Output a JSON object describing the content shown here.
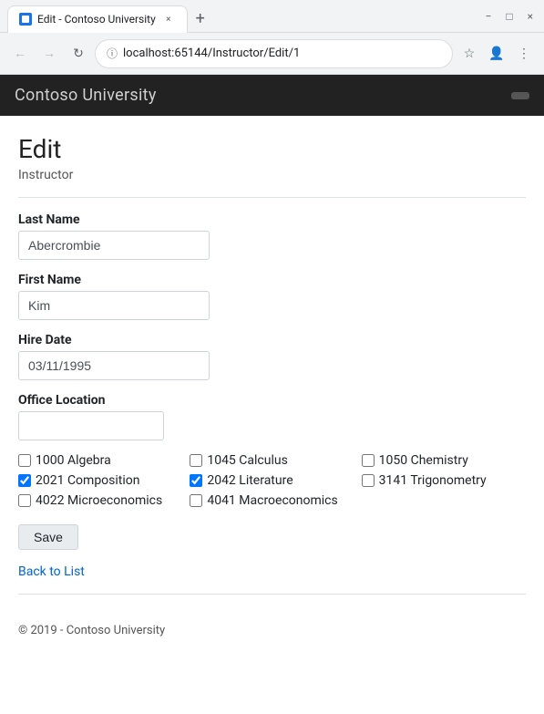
{
  "browser": {
    "tab_title": "Edit - Contoso University",
    "url": "localhost:65144/Instructor/Edit/1",
    "new_tab_symbol": "+",
    "close_symbol": "×",
    "back_symbol": "←",
    "forward_symbol": "→",
    "reload_symbol": "↻",
    "star_symbol": "☆",
    "account_symbol": "👤",
    "menu_symbol": "⋮",
    "lock_symbol": "🔒",
    "window_minimize": "−",
    "window_maximize": "□",
    "window_close": "×"
  },
  "navbar": {
    "brand": "Contoso University",
    "button_label": ""
  },
  "page": {
    "title": "Edit",
    "subtitle": "Instructor"
  },
  "form": {
    "last_name_label": "Last Name",
    "last_name_value": "Abercrombie",
    "first_name_label": "First Name",
    "first_name_value": "Kim",
    "hire_date_label": "Hire Date",
    "hire_date_value": "03/11/1995",
    "office_location_label": "Office Location",
    "office_location_value": "",
    "save_button": "Save"
  },
  "courses": [
    {
      "id": "1000",
      "name": "Algebra",
      "checked": false
    },
    {
      "id": "1045",
      "name": "Calculus",
      "checked": false
    },
    {
      "id": "1050",
      "name": "Chemistry",
      "checked": false
    },
    {
      "id": "2021",
      "name": "Composition",
      "checked": true
    },
    {
      "id": "2042",
      "name": "Literature",
      "checked": true
    },
    {
      "id": "3141",
      "name": "Trigonometry",
      "checked": false
    },
    {
      "id": "4022",
      "name": "Microeconomics",
      "checked": false
    },
    {
      "id": "4041",
      "name": "Macroeconomics",
      "checked": false
    }
  ],
  "links": {
    "back_to_list": "Back to List"
  },
  "footer": {
    "copyright": "© 2019 - Contoso University"
  }
}
